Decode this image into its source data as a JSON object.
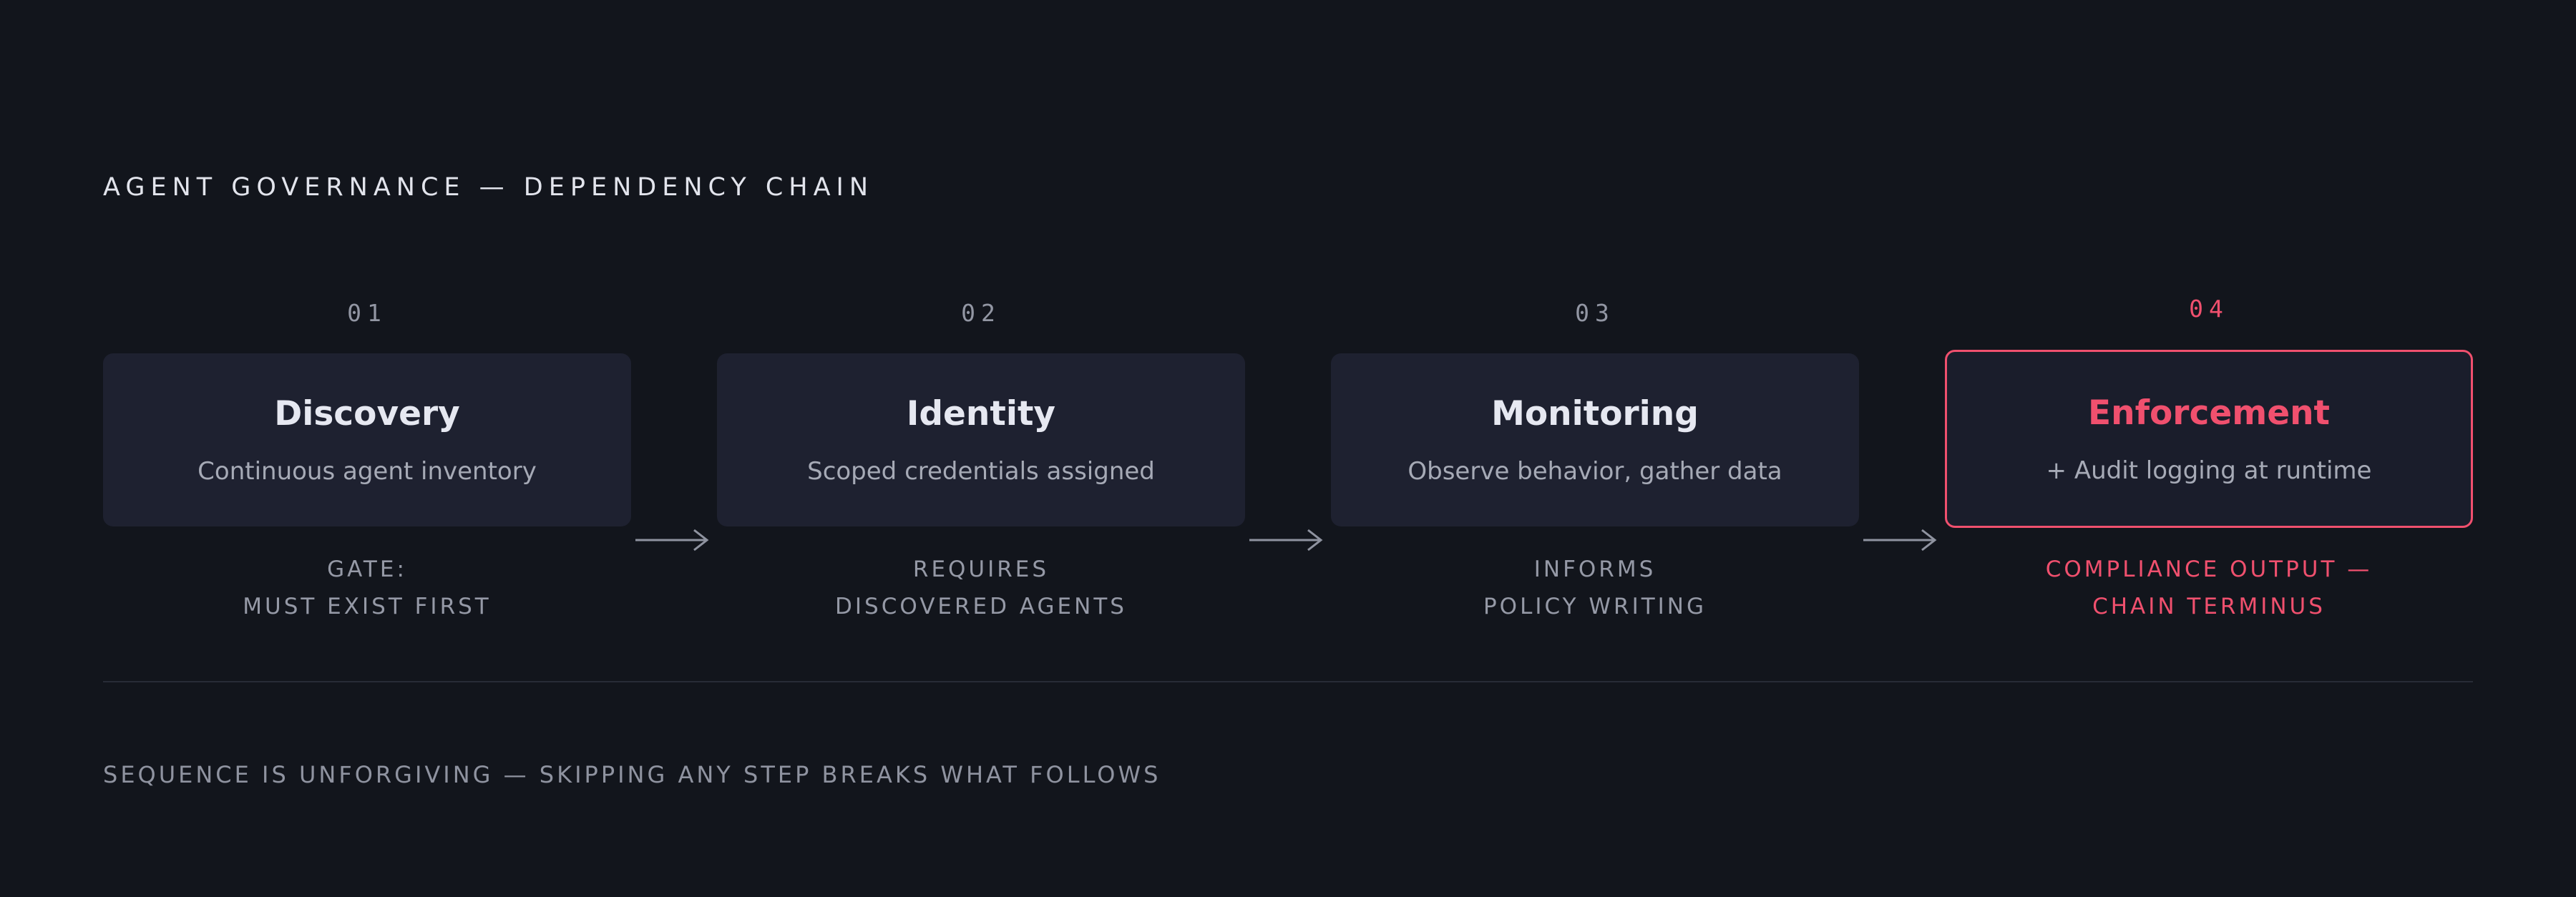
{
  "title": "AGENT GOVERNANCE — DEPENDENCY CHAIN",
  "steps": [
    {
      "number": "01",
      "title": "Discovery",
      "description": "Continuous agent inventory",
      "note_line1": "GATE:",
      "note_line2": "MUST EXIST FIRST"
    },
    {
      "number": "02",
      "title": "Identity",
      "description": "Scoped credentials assigned",
      "note_line1": "REQUIRES",
      "note_line2": "DISCOVERED AGENTS"
    },
    {
      "number": "03",
      "title": "Monitoring",
      "description": "Observe behavior, gather data",
      "note_line1": "INFORMS",
      "note_line2": "POLICY WRITING"
    },
    {
      "number": "04",
      "title": "Enforcement",
      "description": "+ Audit logging at runtime",
      "note_line1": "COMPLIANCE OUTPUT —",
      "note_line2": "CHAIN TERMINUS"
    }
  ],
  "footer": "SEQUENCE IS UNFORGIVING — SKIPPING ANY STEP BREAKS WHAT FOLLOWS",
  "colors": {
    "background": "#12151c",
    "card": "#1e2130",
    "accent": "#f0506e",
    "muted_text": "#9599a6"
  }
}
